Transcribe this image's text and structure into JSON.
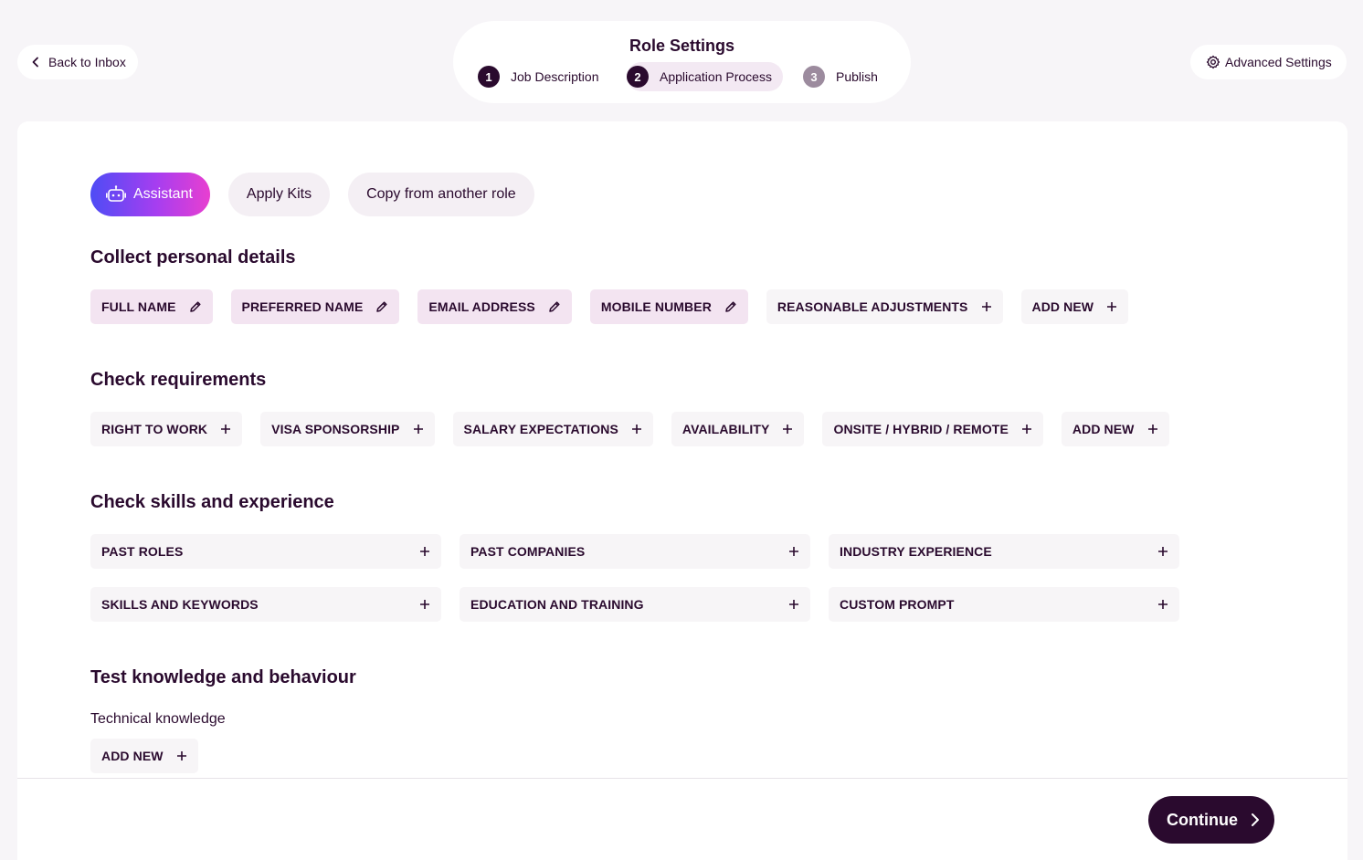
{
  "header": {
    "back_label": "Back to Inbox",
    "title": "Role Settings",
    "advanced_label": "Advanced Settings",
    "steps": [
      {
        "num": "1",
        "label": "Job Description"
      },
      {
        "num": "2",
        "label": "Application Process"
      },
      {
        "num": "3",
        "label": "Publish"
      }
    ]
  },
  "actions": {
    "assistant": "Assistant",
    "apply_kits": "Apply Kits",
    "copy": "Copy from another role"
  },
  "personal": {
    "title": "Collect personal details",
    "chips": [
      "FULL NAME",
      "PREFERRED NAME",
      "EMAIL ADDRESS",
      "MOBILE NUMBER",
      "REASONABLE ADJUSTMENTS",
      "ADD NEW"
    ]
  },
  "requirements": {
    "title": "Check requirements",
    "chips": [
      "RIGHT TO WORK",
      "VISA SPONSORSHIP",
      "SALARY EXPECTATIONS",
      "AVAILABILITY",
      "ONSITE / HYBRID / REMOTE",
      "ADD NEW"
    ]
  },
  "skills": {
    "title": "Check skills and experience",
    "items": [
      "PAST ROLES",
      "PAST COMPANIES",
      "INDUSTRY EXPERIENCE",
      "SKILLS AND KEYWORDS",
      "EDUCATION AND TRAINING",
      "CUSTOM PROMPT"
    ]
  },
  "knowledge": {
    "title": "Test knowledge and behaviour",
    "subtitle": "Technical knowledge",
    "add_new": "ADD NEW"
  },
  "footer": {
    "continue": "Continue"
  },
  "colors": {
    "primary": "#2a0a2e",
    "chip_filled": "#f3e4f1",
    "chip_default": "#f7f5f7",
    "assistant_gradient_start": "#4e4cf5",
    "assistant_gradient_end": "#e83fd0"
  }
}
